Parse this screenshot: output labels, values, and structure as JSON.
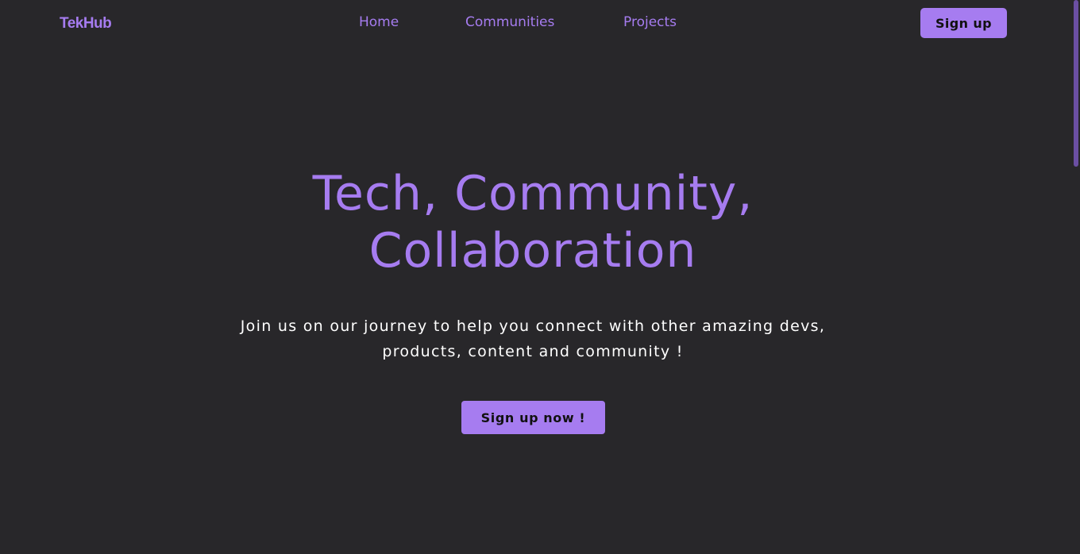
{
  "header": {
    "logo": "TekHub",
    "nav": [
      {
        "label": "Home"
      },
      {
        "label": "Communities"
      },
      {
        "label": "Projects"
      }
    ],
    "signup_label": "Sign up"
  },
  "hero": {
    "title_line1": "Tech, Community,",
    "title_line2": "Collaboration",
    "subtitle_line1": "Join us on our journey to help you connect with other amazing devs,",
    "subtitle_line2": "products, content and community !",
    "cta_label": "Sign up now !"
  },
  "theme": {
    "background": "#28272a",
    "accent": "#a67cf0",
    "text": "#ffffff"
  }
}
